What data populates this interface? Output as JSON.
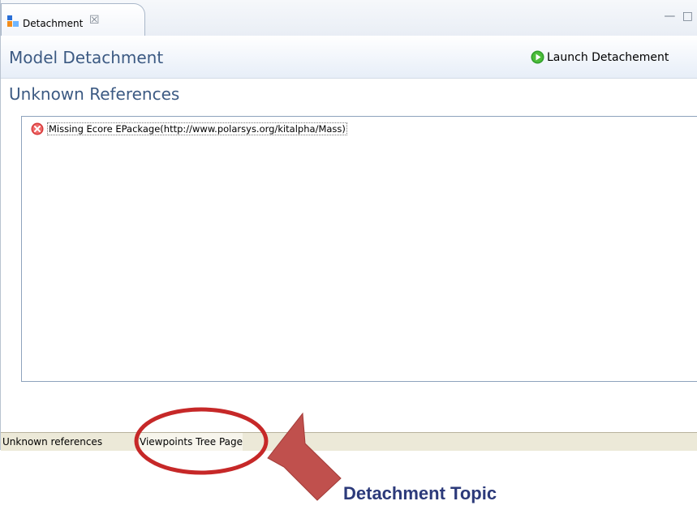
{
  "tab": {
    "title": "Detachment",
    "close_glyph": "☒",
    "icon": "detachment-icon"
  },
  "window_controls": "— □",
  "header": {
    "title": "Model Detachment",
    "launch_label": "Launch Detachement",
    "launch_icon": "play-icon"
  },
  "section": {
    "title": "Unknown References"
  },
  "tree": {
    "items": [
      {
        "label": "Missing Ecore EPackage(http://www.polarsys.org/kitalpha/Mass)",
        "icon": "error-icon"
      }
    ]
  },
  "page_tabs": [
    {
      "label": "Unknown references"
    },
    {
      "label": "Viewpoints Tree Page"
    }
  ],
  "annotation": {
    "label": "Detachment Topic",
    "color": "#c0392b"
  }
}
